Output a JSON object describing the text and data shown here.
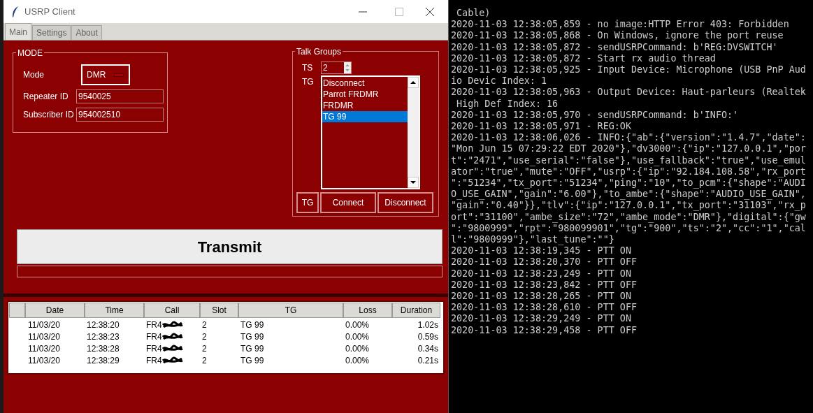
{
  "window": {
    "title": "USRP Client"
  },
  "tabs": [
    {
      "label": "Main",
      "selected": true
    },
    {
      "label": "Settings",
      "selected": false
    },
    {
      "label": "About",
      "selected": false
    }
  ],
  "mode_frame": {
    "title": "MODE",
    "mode_label": "Mode",
    "mode_value": "DMR",
    "repeater_label": "Repeater ID",
    "repeater_value": "9540025",
    "subscriber_label": "Subscriber ID",
    "subscriber_value": "954002510"
  },
  "talk_groups": {
    "title": "Talk Groups",
    "ts_label": "TS",
    "ts_value": "2",
    "tg_label": "TG",
    "items": [
      {
        "label": "Disconnect",
        "selected": false
      },
      {
        "label": "Parrot FRDMR",
        "selected": false
      },
      {
        "label": "FRDMR",
        "selected": false
      },
      {
        "label": "TG 99",
        "selected": true
      }
    ],
    "buttons": [
      "TG",
      "Connect",
      "Disconnect"
    ]
  },
  "transmit": {
    "label": "Transmit"
  },
  "table": {
    "columns": [
      "Date",
      "Time",
      "Call",
      "Slot",
      "TG",
      "Loss",
      "Duration"
    ],
    "rows": [
      [
        "11/03/20",
        "12:38:20",
        "FR4",
        "2",
        "TG 99",
        "0.00%",
        "1.02s"
      ],
      [
        "11/03/20",
        "12:38:23",
        "FR4",
        "2",
        "TG 99",
        "0.00%",
        "0.59s"
      ],
      [
        "11/03/20",
        "12:38:28",
        "FR4",
        "2",
        "TG 99",
        "0.00%",
        "0.34s"
      ],
      [
        "11/03/20",
        "12:38:29",
        "FR4",
        "2",
        "TG 99",
        "0.00%",
        "0.21s"
      ]
    ]
  },
  "console": {
    "lines": [
      " Cable)",
      "2020-11-03 12:38:05,859 - no image:HTTP Error 403: Forbidden",
      "2020-11-03 12:38:05,868 - On Windows, ignore the port reuse",
      "2020-11-03 12:38:05,872 - sendUSRPCommand: b'REG:DVSWITCH'",
      "2020-11-03 12:38:05,872 - Start rx audio thread",
      "2020-11-03 12:38:05,925 - Input Device: Microphone (USB PnP Aud",
      "io Devic Index: 1",
      "2020-11-03 12:38:05,963 - Output Device: Haut-parleurs (Realtek",
      " High Def Index: 16",
      "2020-11-03 12:38:05,970 - sendUSRPCommand: b'INFO:'",
      "2020-11-03 12:38:05,971 - REG:OK",
      "2020-11-03 12:38:06,026 - INFO:{\"ab\":{\"version\":\"1.4.7\",\"date\":",
      "\"Mon Jun 15 07:29:22 EDT 2020\"},\"dv3000\":{\"ip\":\"127.0.0.1\",\"por",
      "t\":\"2471\",\"use_serial\":\"false\"},\"use_fallback\":\"true\",\"use_emul",
      "ator\":\"true\",\"mute\":\"OFF\",\"usrp\":{\"ip\":\"92.184.108.58\",\"rx_port",
      "\":\"51234\",\"tx_port\":\"51234\",\"ping\":\"10\",\"to_pcm\":{\"shape\":\"AUDI",
      "O_USE_GAIN\",\"gain\":\"6.00\"},\"to_ambe\":{\"shape\":\"AUDIO_USE_GAIN\",",
      "\"gain\":\"0.40\"}},\"tlv\":{\"ip\":\"127.0.0.1\",\"tx_port\":\"31103\",\"rx_p",
      "ort\":\"31100\",\"ambe_size\":\"72\",\"ambe_mode\":\"DMR\"},\"digital\":{\"gw",
      "\":\"9800999\",\"rpt\":\"980099901\",\"tg\":\"900\",\"ts\":\"2\",\"cc\":\"1\",\"cal",
      "l\":\"9800999\"},\"last_tune\":\"\"}",
      "2020-11-03 12:38:19,345 - PTT ON",
      "2020-11-03 12:38:20,370 - PTT OFF",
      "2020-11-03 12:38:23,249 - PTT ON",
      "2020-11-03 12:38:23,842 - PTT OFF",
      "2020-11-03 12:38:28,265 - PTT ON",
      "2020-11-03 12:38:28,610 - PTT OFF",
      "2020-11-03 12:38:29,249 - PTT ON",
      "2020-11-03 12:38:29,458 - PTT OFF"
    ]
  }
}
